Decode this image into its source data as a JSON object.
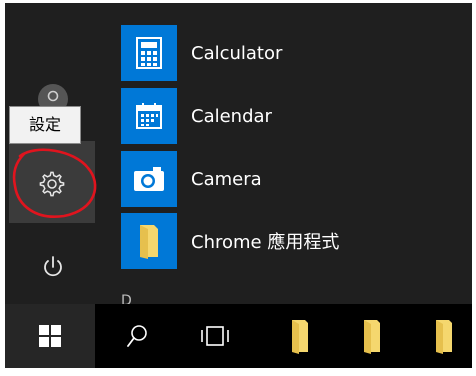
{
  "start_menu": {
    "tooltip": "設定",
    "section_letter": "D",
    "apps": [
      {
        "label": "Calculator",
        "icon": "calculator-icon"
      },
      {
        "label": "Calendar",
        "icon": "calendar-icon"
      },
      {
        "label": "Camera",
        "icon": "camera-icon"
      },
      {
        "label": "Chrome 應用程式",
        "icon": "folder-icon"
      }
    ],
    "rail": {
      "user_icon": "user-icon",
      "settings_icon": "gear-icon",
      "power_icon": "power-icon"
    }
  },
  "taskbar": {
    "items": [
      "windows-logo-icon",
      "search-icon",
      "task-view-icon",
      "folder-icon",
      "folder-icon",
      "folder-icon"
    ]
  },
  "colors": {
    "menu_bg": "#1f1f1f",
    "tile_blue": "#0078d7",
    "taskbar_bg": "#000000",
    "annotation_red": "#e0141e",
    "folder_yellow": "#f5d76e"
  }
}
